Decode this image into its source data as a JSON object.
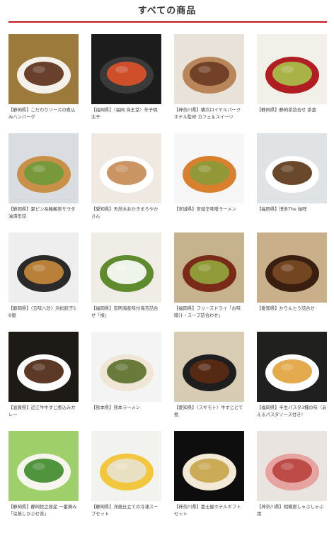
{
  "page": {
    "heading": "すべての商品",
    "accent_color": "#c8161d"
  },
  "products": [
    {
      "caption": "【静岡県】こだわりソースの煮込みハンバーグ",
      "image": "hamburg-steak-plate",
      "palette": [
        "#9c7a3c",
        "#f4f1ea",
        "#5a2c16"
      ]
    },
    {
      "caption": "【福岡県】〈福岡 海王堂〉辛子明太子",
      "image": "mentaiko-on-slate",
      "palette": [
        "#1c1c1c",
        "#3a3a3a",
        "#e0522a"
      ]
    },
    {
      "caption": "【神奈川県】横浜ロイヤルパークホテル監修 カフェ＆スイーツ",
      "image": "cafe-sweets-set",
      "palette": [
        "#e8e2d8",
        "#b8865a",
        "#6b3a22"
      ]
    },
    {
      "caption": "【静岡県】静岡茶詰合せ 茶倉",
      "image": "green-tea-cups",
      "palette": [
        "#f3efe9",
        "#b01e23",
        "#a9c24a"
      ]
    },
    {
      "caption": "【静岡県】夏ピン長鮪鮪実サラダ油漬缶詰",
      "image": "tuna-sandwich",
      "palette": [
        "#d9dde2",
        "#c9904a",
        "#6e9a3a"
      ]
    },
    {
      "caption": "【愛知県】天然木おかきまろやかさん",
      "image": "rice-crackers-platter",
      "palette": [
        "#efe9e2",
        "#ffffff",
        "#c58a52"
      ]
    },
    {
      "caption": "【宮城県】宮城辛味噌ラーメン",
      "image": "miso-ramen-bowl",
      "palette": [
        "#f6f6f6",
        "#d9802e",
        "#8a9a3a"
      ]
    },
    {
      "caption": "【福岡県】博多The 伽哩",
      "image": "curry-rice-plate",
      "palette": [
        "#dfe3e6",
        "#ffffff",
        "#5a3414"
      ]
    },
    {
      "caption": "【静岡県】〈五味八珍〉浜松餃子56個",
      "image": "gyoza-round-plate",
      "palette": [
        "#eeeeee",
        "#2a2a2a",
        "#c98a3c"
      ]
    },
    {
      "caption": "【福岡県】有明海産味付海苔詰合せ「振」",
      "image": "onigiri-nori-set",
      "palette": [
        "#f0ece6",
        "#5f8a2e",
        "#ffffff"
      ]
    },
    {
      "caption": "【福岡県】フリーズドライ「お味噌汁・スープ詰合わせ」",
      "image": "miso-soup-bowls",
      "palette": [
        "#c7b28e",
        "#7a2a18",
        "#93a63d"
      ]
    },
    {
      "caption": "【愛知県】かりんとう詰合せ",
      "image": "karinto-snacks",
      "palette": [
        "#c9b08a",
        "#3a1f10",
        "#7a4a24"
      ]
    },
    {
      "caption": "【滋賀県】近江牛牛すじ煮込みカレー",
      "image": "beef-curry-plate",
      "palette": [
        "#1e1a16",
        "#ffffff",
        "#4a2410"
      ]
    },
    {
      "caption": "【熊本県】熊本ラーメン",
      "image": "kumamoto-ramen",
      "palette": [
        "#f4f4f4",
        "#efe6d6",
        "#5a6e2a"
      ]
    },
    {
      "caption": "【愛知県】〈スギモト〉牛すじどて煮",
      "image": "beef-tendon-stew",
      "palette": [
        "#d8ccb4",
        "#1e1e1e",
        "#5c2a14"
      ]
    },
    {
      "caption": "【福岡県】半生パスタ3種の味（あえるパスタソース付き）",
      "image": "pasta-three-plates",
      "palette": [
        "#20201f",
        "#ffffff",
        "#e0a23a"
      ]
    },
    {
      "caption": "【静岡県】静岡牧之原産 一番摘み「深蒸しかぶせ茶」",
      "image": "matcha-teacup",
      "palette": [
        "#9fcf6a",
        "#f6f6ee",
        "#3f8a2a"
      ]
    },
    {
      "caption": "【静岡県】洋風仕立ての冷凍スープセット",
      "image": "soup-cups-set",
      "palette": [
        "#f2f2ef",
        "#f3c640",
        "#e8e2cf"
      ]
    },
    {
      "caption": "【神奈川県】富士屋ホテルギフトセット",
      "image": "hotel-gift-box",
      "palette": [
        "#0e0e0e",
        "#f2e9d6",
        "#c7a34a"
      ]
    },
    {
      "caption": "【神奈川県】相模原しゃぶしゃぶ用",
      "image": "shabu-shabu-beef",
      "palette": [
        "#e9e4df",
        "#e7a3a0",
        "#b8433f"
      ]
    }
  ]
}
